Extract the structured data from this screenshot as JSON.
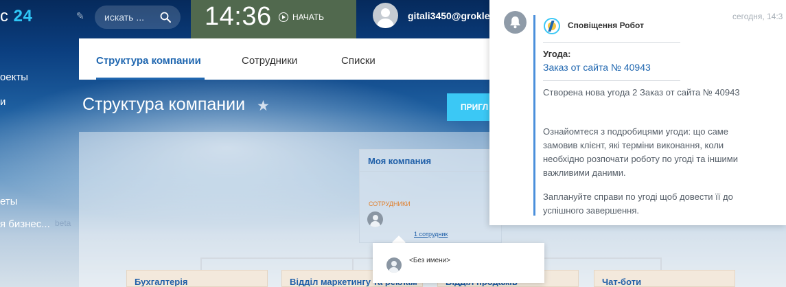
{
  "header": {
    "logo_prefix": "с",
    "logo_number": "24",
    "search_placeholder": "искать ...",
    "time": "14:36",
    "start_label": "НАЧАТЬ",
    "user_name": "gitali3450@grokle"
  },
  "left_menu": {
    "items": [
      {
        "label": "оекты"
      },
      {
        "label": "и"
      },
      {
        "label": "еты"
      },
      {
        "label": "я бизнес..."
      }
    ],
    "beta_badge": "beta"
  },
  "tabs": [
    {
      "label": "Структура компании",
      "active": true
    },
    {
      "label": "Сотрудники",
      "active": false
    },
    {
      "label": "Списки",
      "active": false
    }
  ],
  "page": {
    "title": "Структура компании",
    "invite_label": "ПРИГЛ"
  },
  "org_chart": {
    "company_title": "Моя компания",
    "staff_label": "СОТРУДНИКИ",
    "staff_count": "1 сотрудник",
    "popup_name": "<Без имени>",
    "departments": [
      {
        "label": "Бухгалтерія"
      },
      {
        "label": "Відділ маркетингу та реклам"
      },
      {
        "label": "Відділ продажів"
      },
      {
        "label": "Чат-боти"
      }
    ]
  },
  "notification": {
    "time": "сегодня, 14:3",
    "sender": "Сповіщення Робот",
    "deal_label": "Угода:",
    "deal_link": "Заказ от сайта № 40943",
    "text_1": "Створена нова угода 2 Заказ от сайта № 40943",
    "text_2": "Ознайомтеся з подробицями угоди: що саме замовив клієнт, які терміни виконання, коли необхідно розпочати роботу по угоді та іншими важливими даними.",
    "text_3": "Заплануйте справи по угоді щоб довести її до успішного завершення."
  },
  "colors": {
    "accent": "#2067b0",
    "button": "#3bc8f5",
    "clock_block": "#51694e",
    "staff_label": "#e0802d"
  }
}
